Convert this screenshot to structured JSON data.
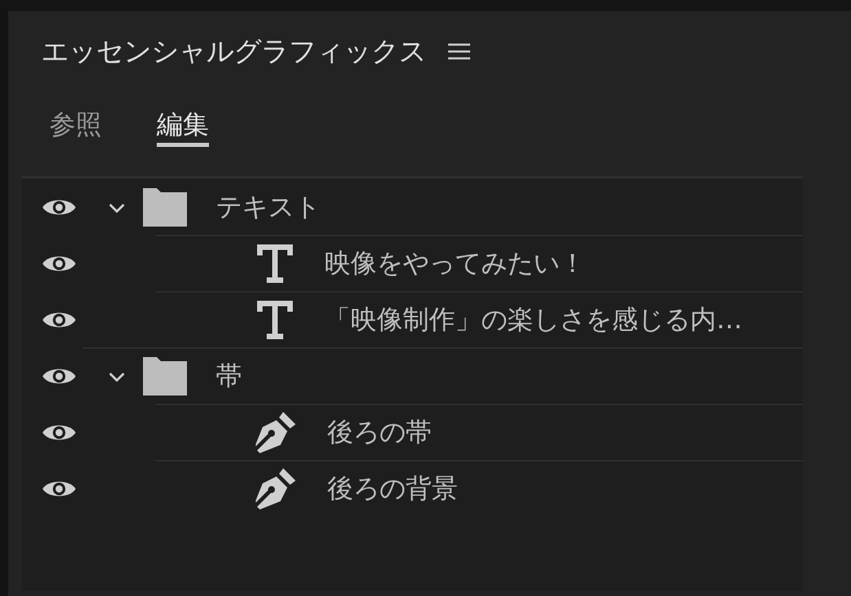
{
  "panel": {
    "title": "エッセンシャルグラフィックス"
  },
  "tabs": [
    {
      "label": "参照",
      "selected": false
    },
    {
      "label": "編集",
      "selected": true
    }
  ],
  "layers": [
    {
      "kind": "group",
      "name": "テキスト",
      "expanded": true,
      "children": [
        {
          "kind": "text",
          "name": "映像をやってみたい！"
        },
        {
          "kind": "text",
          "name": "「映像制作」の楽しさを感じる内…"
        }
      ]
    },
    {
      "kind": "group",
      "name": "帯",
      "expanded": true,
      "children": [
        {
          "kind": "shape",
          "name": "後ろの帯"
        },
        {
          "kind": "shape",
          "name": "後ろの背景"
        }
      ]
    }
  ]
}
